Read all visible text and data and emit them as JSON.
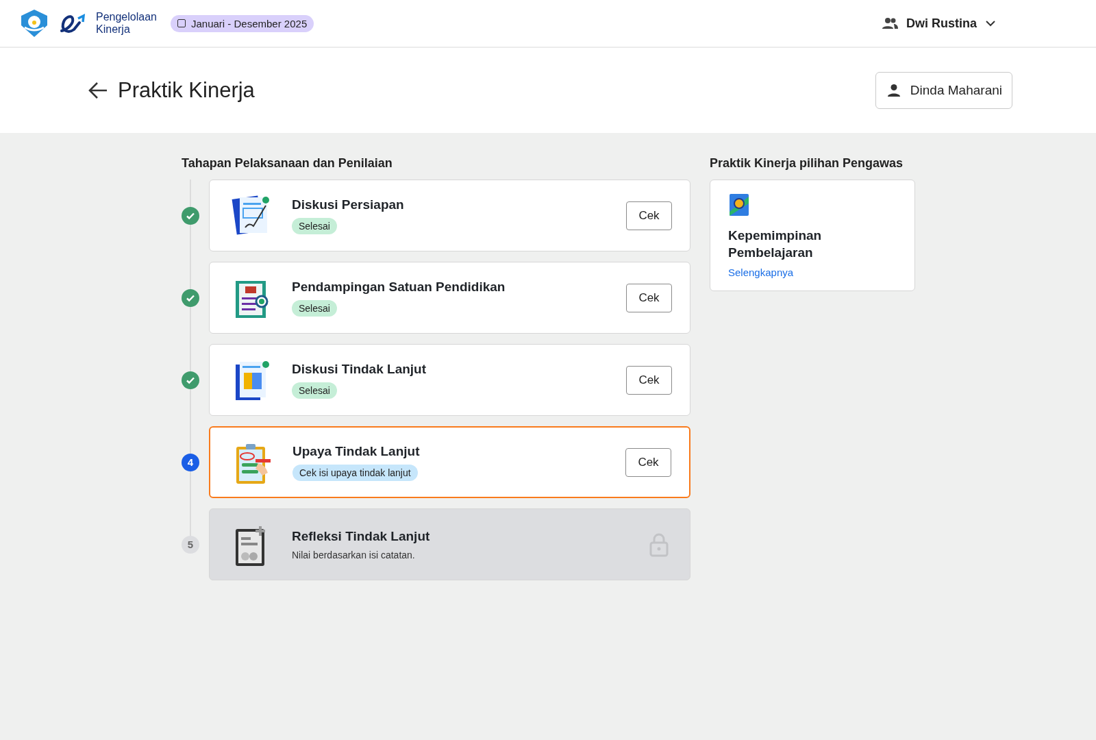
{
  "header": {
    "logo_lines": [
      "Pengelolaan",
      "Kinerja"
    ],
    "period": "Januari - Desember 2025",
    "user": "Dwi Rustina"
  },
  "page": {
    "title": "Praktik Kinerja",
    "person": "Dinda Maharani"
  },
  "stages": {
    "heading": "Tahapan Pelaksanaan dan Penilaian",
    "steps": [
      {
        "kind": "done",
        "title": "Diskusi Persiapan",
        "badge": "Selesai",
        "button": "Cek",
        "selected": false
      },
      {
        "kind": "done",
        "title": "Pendampingan Satuan Pendidikan",
        "badge": "Selesai",
        "button": "Cek",
        "selected": false
      },
      {
        "kind": "done",
        "title": "Diskusi Tindak Lanjut",
        "badge": "Selesai",
        "button": "Cek",
        "selected": false
      },
      {
        "kind": "current",
        "number": "4",
        "title": "Upaya Tindak Lanjut",
        "badge": "Cek isi upaya tindak lanjut",
        "button": "Cek",
        "selected": true
      },
      {
        "kind": "locked",
        "number": "5",
        "title": "Refleksi Tindak Lanjut",
        "note": "Nilai berdasarkan isi catatan.",
        "selected": false
      }
    ]
  },
  "sidebar": {
    "heading": "Praktik Kinerja pilihan Pengawas",
    "card": {
      "title": "Kepemimpinan Pembelajaran",
      "link": "Selengkapnya"
    }
  }
}
